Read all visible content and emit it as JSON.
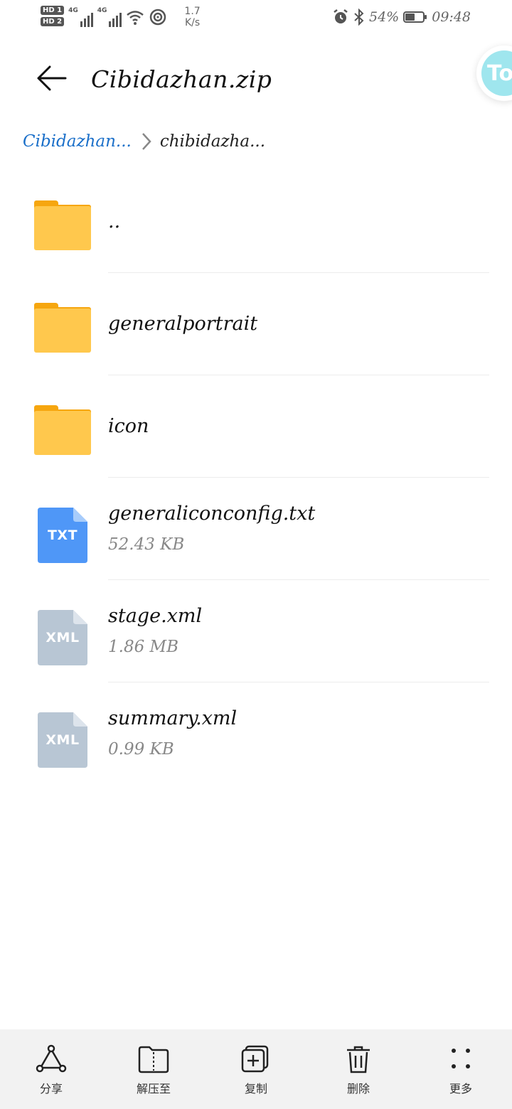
{
  "status_bar": {
    "hd1": "HD 1",
    "hd2": "HD 2",
    "net1": "4G",
    "net2": "4G",
    "speed_value": "1.7",
    "speed_unit": "K/s",
    "battery_percent": "54%",
    "battery_level": 0.54,
    "time": "09:48"
  },
  "header": {
    "title": "Cibidazhan.zip",
    "float_ball_text": "To"
  },
  "breadcrumb": {
    "root": "Cibidazhan...",
    "current": "chibidazha..."
  },
  "files": [
    {
      "name": "..",
      "type": "folder",
      "size": ""
    },
    {
      "name": "generalportrait",
      "type": "folder",
      "size": ""
    },
    {
      "name": "icon",
      "type": "folder",
      "size": ""
    },
    {
      "name": "generaliconconfig.txt",
      "type": "txt",
      "size": "52.43 KB",
      "badge": "TXT",
      "color": "#4f97f7"
    },
    {
      "name": "stage.xml",
      "type": "xml",
      "size": "1.86 MB",
      "badge": "XML",
      "color": "#b8c6d4"
    },
    {
      "name": "summary.xml",
      "type": "xml",
      "size": "0.99 KB",
      "badge": "XML",
      "color": "#b8c6d4"
    }
  ],
  "toolbar": {
    "share": "分享",
    "extract": "解压至",
    "copy": "复制",
    "delete": "删除",
    "more": "更多"
  },
  "colors": {
    "accent_link": "#1a6fc9",
    "folder": "#ffc84d",
    "folder_tab": "#f6a60f",
    "txt_icon": "#4f97f7",
    "xml_icon": "#b8c6d4",
    "toolbar_bg": "#f2f2f2"
  }
}
